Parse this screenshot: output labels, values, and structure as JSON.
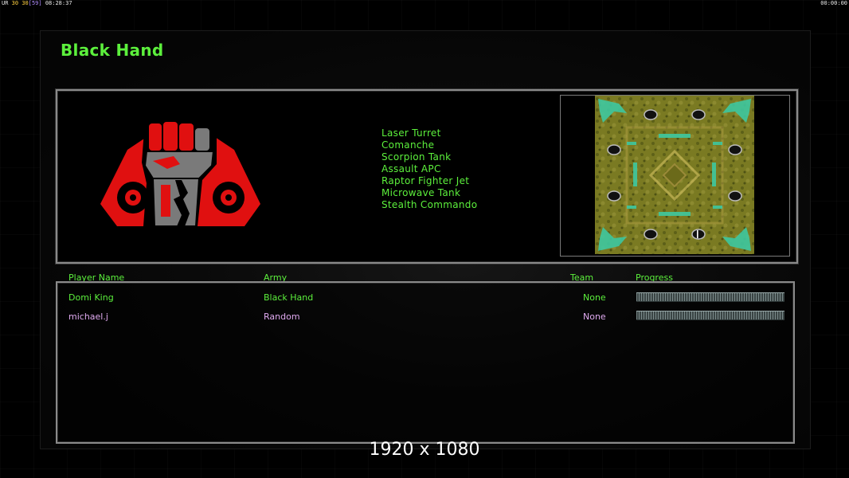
{
  "hud": {
    "left_prefix": "UR",
    "left_a": "30",
    "left_b": "30",
    "left_c": "[59]",
    "left_time": "08:28:37",
    "right_time": "00:00:00"
  },
  "faction": {
    "title": "Black Hand",
    "units": [
      "Laser Turret",
      "Comanche",
      "Scorpion Tank",
      "Assault APC",
      "Raptor Fighter Jet",
      "Microwave Tank",
      "Stealth Commando"
    ]
  },
  "table": {
    "headers": {
      "player": "Player Name",
      "army": "Army",
      "team": "Team",
      "progress": "Progress"
    },
    "rows": [
      {
        "player": "Domi King",
        "army": "Black Hand",
        "team": "None",
        "progress": 0,
        "color": "#5cf03c"
      },
      {
        "player": "michael.j",
        "army": "Random",
        "team": "None",
        "progress": 0,
        "color": "#e0aaf0"
      }
    ]
  },
  "resolution_label": "1920 x 1080",
  "colors": {
    "accent": "#5cf03c",
    "player2": "#e0aaf0",
    "logo_red": "#e01010"
  }
}
